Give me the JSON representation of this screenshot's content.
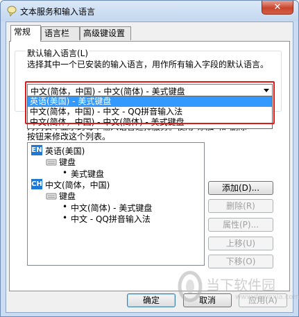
{
  "window": {
    "title": "文本服务和输入语言",
    "close_glyph": "✕"
  },
  "tabs": [
    {
      "label": "常规",
      "active": true
    },
    {
      "label": "语言栏",
      "active": false
    },
    {
      "label": "高级键设置",
      "active": false
    }
  ],
  "default_input": {
    "group_label": "默认输入语言(L)",
    "description": "选择其中一个已安装的输入语言，用作所有输入字段的默认语言。",
    "selected_value": "中文(简体，中国) - 中文(简体) - 美式键盘",
    "options": [
      "英语(美国) - 美式键盘",
      "中文(简体，中国) - 中文 - QQ拼音输入法",
      "中文(简体，中国) - 中文(简体) - 美式键盘"
    ],
    "highlighted_index": 0
  },
  "installed_services": {
    "desc_line1": "为列表中显示的每个输入语言选择服务。使用\"添加\"和\"删除\"",
    "desc_line2": "按钮来修改这个列表。",
    "tree": [
      {
        "badge": "EN",
        "label": "英语(美国)",
        "keyboard_label": "键盘",
        "layouts": [
          "美式键盘"
        ]
      },
      {
        "badge": "CH",
        "label": "中文(简体，中国)",
        "keyboard_label": "键盘",
        "layouts": [
          "中文(简体) - 美式键盘",
          "中文 - QQ拼音输入法"
        ]
      }
    ]
  },
  "side_buttons": {
    "add": "添加(D)...",
    "remove": "删除(R)",
    "properties": "属性(P)...",
    "move_up": "上移(U)",
    "move_down": "下移(O)"
  },
  "footer_buttons": {
    "ok": "确定",
    "cancel": "取消",
    "apply": "应用(A)"
  },
  "watermark": {
    "text": "当下软件园",
    "url": "www.downxia.com"
  },
  "colors": {
    "selection": "#3399ff",
    "badge": "#1e78d6",
    "highlight_box": "#e01818"
  }
}
